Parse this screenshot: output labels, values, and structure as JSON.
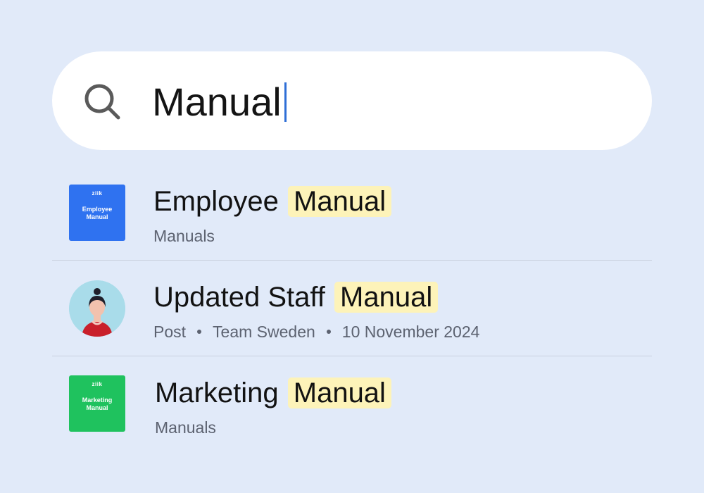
{
  "search": {
    "value": "Manual"
  },
  "results": [
    {
      "title_prefix": "Employee",
      "title_match": "Manual",
      "meta": [
        "Manuals"
      ],
      "thumb": {
        "type": "document",
        "brand": "ziik",
        "title": "Employee Manual",
        "color": "#2f72f0"
      }
    },
    {
      "title_prefix": "Updated Staff",
      "title_match": "Manual",
      "meta": [
        "Post",
        "Team Sweden",
        "10 November 2024"
      ],
      "thumb": {
        "type": "avatar",
        "color": "#a9dcea"
      }
    },
    {
      "title_prefix": "Marketing",
      "title_match": "Manual",
      "meta": [
        "Manuals"
      ],
      "thumb": {
        "type": "document",
        "brand": "ziik",
        "title": "Marketing Manual",
        "color": "#1fc25e"
      }
    }
  ],
  "colors": {
    "background": "#e1eaf9",
    "highlight": "#fdf3b9",
    "caret": "#2f6fd6"
  }
}
